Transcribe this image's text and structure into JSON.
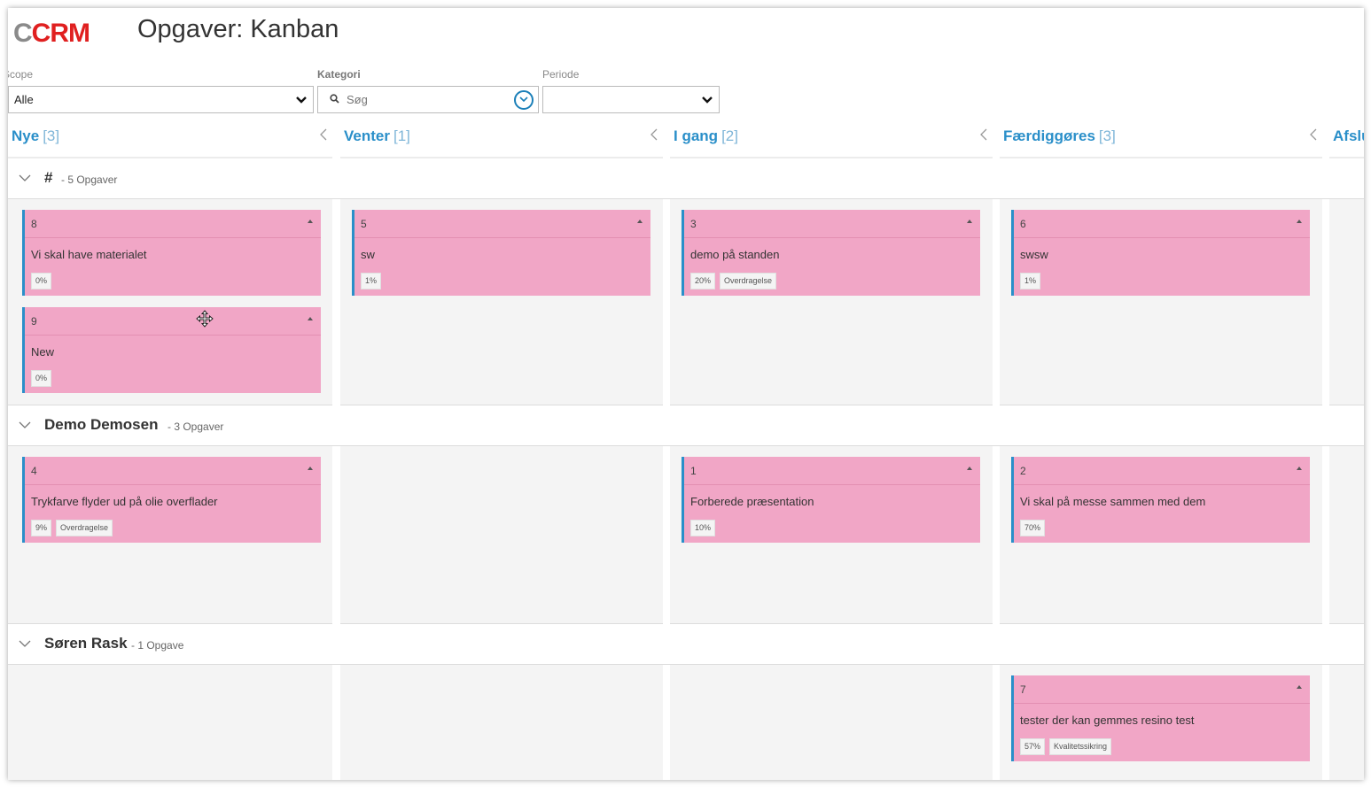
{
  "header": {
    "logo_gray": "C",
    "logo_red": "CRM",
    "title": "Opgaver: Kanban"
  },
  "filters": {
    "scope": {
      "label": "Scope",
      "value": "Alle"
    },
    "kategori": {
      "label": "Kategori",
      "placeholder": "Søg"
    },
    "periode": {
      "label": "Periode",
      "value": ""
    }
  },
  "columns": [
    {
      "name": "Nye",
      "count": "[3]"
    },
    {
      "name": "Venter",
      "count": "[1]"
    },
    {
      "name": "I gang",
      "count": "[2]"
    },
    {
      "name": "Færdiggøres",
      "count": "[3]"
    },
    {
      "name": "Afslu",
      "count": ""
    }
  ],
  "lanes": [
    {
      "name": "#",
      "count": "- 5 Opgaver"
    },
    {
      "name": "Demo Demosen",
      "count": "- 3 Opgaver"
    },
    {
      "name": "Søren Rask",
      "count": "- 1 Opgave"
    }
  ],
  "cards": [
    {
      "id": "8",
      "title": "Vi skal have materialet",
      "progress": "0%",
      "tag": ""
    },
    {
      "id": "9",
      "title": "New",
      "progress": "0%",
      "tag": ""
    },
    {
      "id": "5",
      "title": "sw",
      "progress": "1%",
      "tag": ""
    },
    {
      "id": "3",
      "title": "demo på standen",
      "progress": "20%",
      "tag": "Overdragelse"
    },
    {
      "id": "6",
      "title": "swsw",
      "progress": "1%",
      "tag": ""
    },
    {
      "id": "4",
      "title": "Trykfarve flyder ud på olie overflader",
      "progress": "9%",
      "tag": "Overdragelse"
    },
    {
      "id": "1",
      "title": "Forberede præsentation",
      "progress": "10%",
      "tag": ""
    },
    {
      "id": "2",
      "title": "Vi skal på messe sammen med dem",
      "progress": "70%",
      "tag": ""
    },
    {
      "id": "7",
      "title": "tester der kan gemmes resino test",
      "progress": "57%",
      "tag": "Kvalitetssikring"
    }
  ],
  "colors": {
    "accent": "#2a8fc9",
    "card": "#f1a6c6",
    "logo_red": "#e02020"
  }
}
